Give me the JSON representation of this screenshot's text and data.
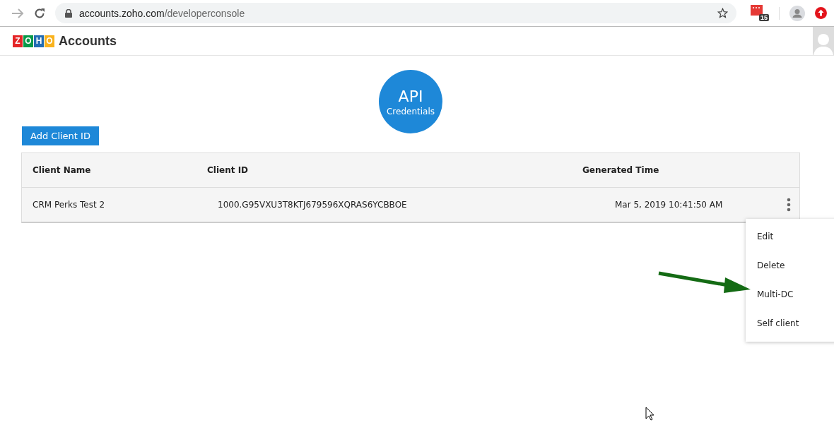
{
  "browser": {
    "url_host": "accounts.zoho.com",
    "url_path": "/developerconsole",
    "extension_badge": "15"
  },
  "header": {
    "logo_letters": [
      "Z",
      "O",
      "H",
      "O"
    ],
    "title": "Accounts"
  },
  "badge": {
    "title": "API",
    "subtitle": "Credentials"
  },
  "add_button": "Add Client ID",
  "table": {
    "columns": [
      "Client Name",
      "Client ID",
      "Generated Time"
    ],
    "rows": [
      {
        "client_name": "CRM Perks Test 2",
        "client_id": "1000.G95VXU3T8KTJ679596XQRAS6YCBBOE",
        "generated_time": "Mar 5, 2019 10:41:50 AM"
      }
    ]
  },
  "menu": {
    "items": [
      "Edit",
      "Delete",
      "Multi-DC",
      "Self client"
    ]
  }
}
